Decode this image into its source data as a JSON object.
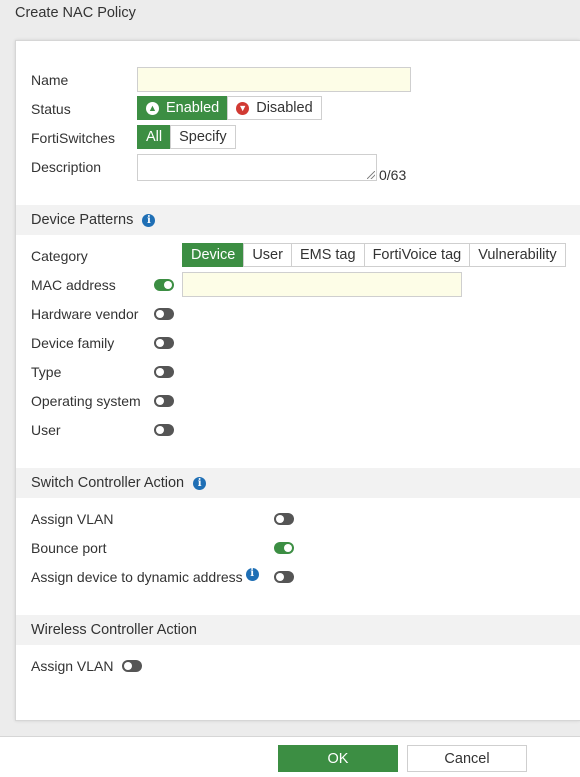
{
  "window": {
    "title": "Create NAC Policy"
  },
  "form": {
    "name_label": "Name",
    "name_value": "",
    "status_label": "Status",
    "status_enabled": "Enabled",
    "status_disabled": "Disabled",
    "status_selected": "Enabled",
    "fortiswitches_label": "FortiSwitches",
    "fortiswitches_all": "All",
    "fortiswitches_specify": "Specify",
    "fortiswitches_selected": "All",
    "description_label": "Description",
    "description_value": "",
    "description_counter": "0/63"
  },
  "device_patterns": {
    "title": "Device Patterns",
    "category_label": "Category",
    "category_tabs": [
      "Device",
      "User",
      "EMS tag",
      "FortiVoice tag",
      "Vulnerability"
    ],
    "category_selected": "Device",
    "mac_label": "MAC address",
    "mac_enabled": true,
    "mac_value": "",
    "hardware_vendor_label": "Hardware vendor",
    "hardware_vendor_enabled": false,
    "device_family_label": "Device family",
    "device_family_enabled": false,
    "type_label": "Type",
    "type_enabled": false,
    "os_label": "Operating system",
    "os_enabled": false,
    "user_label": "User",
    "user_enabled": false
  },
  "switch_action": {
    "title": "Switch Controller Action",
    "assign_vlan_label": "Assign VLAN",
    "assign_vlan_enabled": false,
    "bounce_port_label": "Bounce port",
    "bounce_port_enabled": true,
    "dynamic_address_label": "Assign device to dynamic address",
    "dynamic_address_enabled": false
  },
  "wireless_action": {
    "title": "Wireless Controller Action",
    "assign_vlan_label": "Assign VLAN",
    "assign_vlan_enabled": false
  },
  "footer": {
    "ok_label": "OK",
    "cancel_label": "Cancel"
  },
  "colors": {
    "accent": "#3c8e43",
    "input_bg": "#fdfde7",
    "info": "#1f6fb5",
    "danger": "#d13a33"
  }
}
